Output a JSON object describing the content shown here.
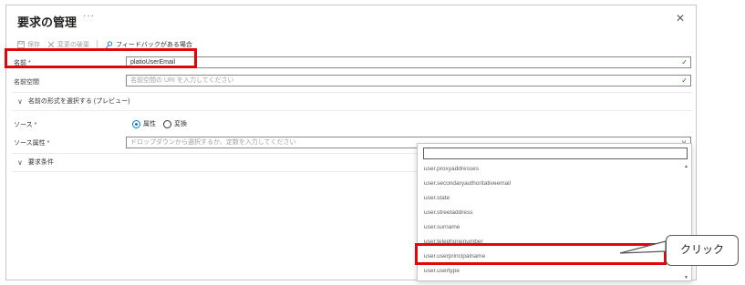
{
  "panel": {
    "title": "要求の管理",
    "more_glyph": "···",
    "close_glyph": "✕"
  },
  "toolbar": {
    "save_label": "保存",
    "discard_label": "変更の破棄",
    "feedback_label": "フィードバックがある場合"
  },
  "form": {
    "name_label": "名前",
    "name_value": "platioUserEmail",
    "namespace_label": "名前空間",
    "namespace_placeholder": "名前空間の URI を入力してください",
    "format_section": "名前の形式を選択する (プレビュー)",
    "source_label": "ソース",
    "source_options": [
      "属性",
      "変換"
    ],
    "source_selected": "属性",
    "source_attr_label": "ソース属性",
    "source_attr_placeholder": "ドロップダウンから選択するか、定数を入力してください",
    "conditions_section": "要求条件",
    "required_mark": "*"
  },
  "dropdown": {
    "items": [
      "user.proxyaddresses",
      "user.secondaryauthoritativeemail",
      "user.state",
      "user.streetaddress",
      "user.surname",
      "user.telephonenumber",
      "user.userprincipalname",
      "user.usertype"
    ],
    "highlighted_item": "user.userprincipalname"
  },
  "annotation": {
    "callout_text": "クリック",
    "highlight_color": "#e0070b"
  },
  "colors": {
    "accent": "#0078d4",
    "valid_check": "#107c10"
  }
}
